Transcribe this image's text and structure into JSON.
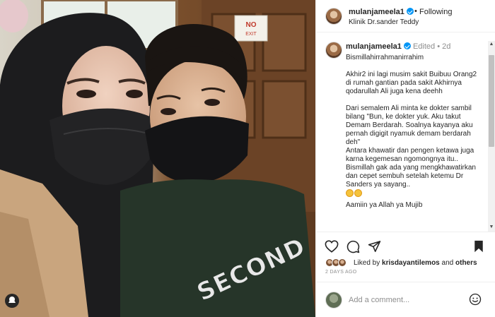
{
  "colors": {
    "accent": "#0095f6",
    "text": "#262626",
    "muted": "#8e8e8e",
    "border": "#efefef"
  },
  "photo": {
    "sign_text_1": "NO",
    "sign_text_2": "EXIT",
    "shirt_text": "SECOND"
  },
  "header": {
    "username": "mulanjameela1",
    "verified_icon": "verified-badge-icon",
    "separator": "•",
    "follow_label": "Following",
    "location": "Klinik Dr.sander Teddy"
  },
  "caption": {
    "username": "mulanjameela1",
    "edited": "Edited",
    "dot": "•",
    "time": "2d",
    "lines": [
      "Bismillahirrahmanirrahim",
      "",
      "Akhir2 ini lagi musim sakit Buibuu Orang2 di rumah gantian pada sakit Akhirnya qodarullah Ali juga kena deehh",
      "",
      "Dari semalem Ali minta ke dokter sambil bilang \"Bun, ke dokter yuk. Aku takut Demam Berdarah. Soalnya kayanya aku pernah digigit nyamuk demam berdarah deh\"",
      "Antara khawatir dan pengen ketawa juga karna kegemesan ngomongnya itu.. Bismillah gak ada yang mengkhawatirkan dan cepet sembuh setelah ketemu Dr Sanders ya sayang..",
      "",
      "Aamiin ya Allah ya Mujib"
    ]
  },
  "actions": {
    "like_icon": "heart-icon",
    "comment_icon": "comment-icon",
    "share_icon": "share-icon",
    "save_icon": "bookmark-icon"
  },
  "likes": {
    "prefix": "Liked by",
    "user": "krisdayantilemos",
    "middle": "and",
    "others": "others"
  },
  "time_ago": "2 DAYS AGO",
  "comment": {
    "placeholder": "Add a comment...",
    "emoji_icon": "smiley-icon"
  }
}
